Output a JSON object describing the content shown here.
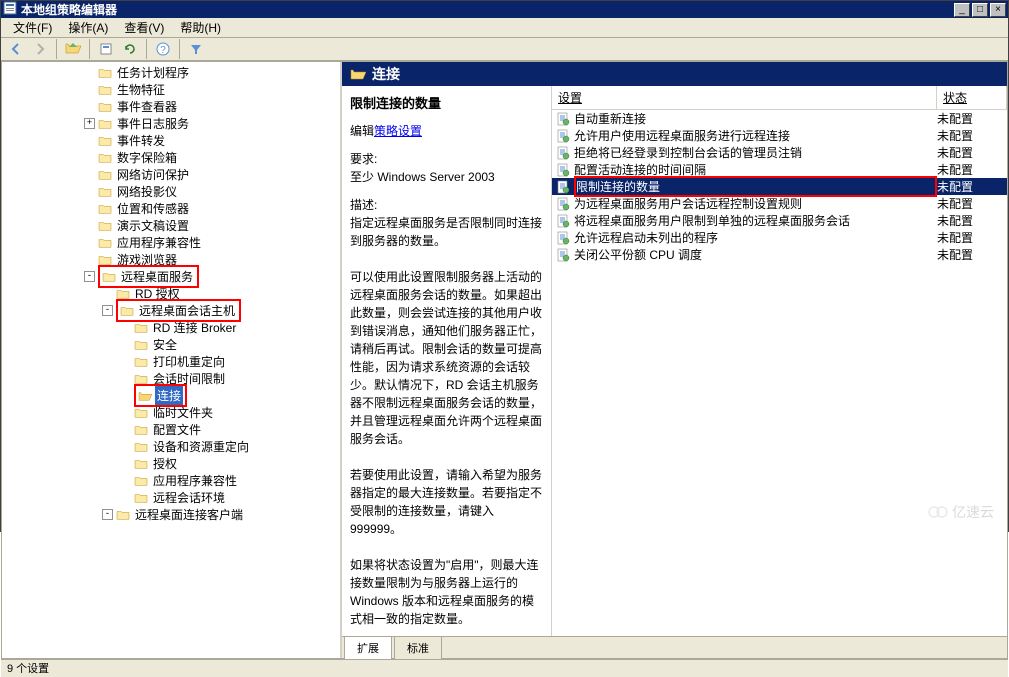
{
  "window": {
    "title": "本地组策略编辑器",
    "minimize": "_",
    "maximize": "□",
    "close": "×"
  },
  "menu": {
    "file": "文件(F)",
    "action": "操作(A)",
    "view": "查看(V)",
    "help": "帮助(H)"
  },
  "tree": {
    "nodes": [
      "任务计划程序",
      "生物特征",
      "事件查看器",
      "事件日志服务",
      "事件转发",
      "数字保险箱",
      "网络访问保护",
      "网络投影仪",
      "位置和传感器",
      "演示文稿设置",
      "应用程序兼容性",
      "游戏浏览器"
    ],
    "rds": "远程桌面服务",
    "rd_auth": "RD 授权",
    "rdsh": "远程桌面会话主机",
    "rdsh_children": [
      "RD 连接 Broker",
      "安全",
      "打印机重定向",
      "会话时间限制"
    ],
    "connections": "连接",
    "rdsh_children2": [
      "临时文件夹",
      "配置文件",
      "设备和资源重定向",
      "授权",
      "应用程序兼容性",
      "远程会话环境"
    ],
    "rdcc": "远程桌面连接客户端"
  },
  "right": {
    "header": "连接",
    "desc_title": "限制连接的数量",
    "edit_label": "编辑",
    "edit_link": "策略设置",
    "req_label": "要求:",
    "req_val": "至少 Windows Server 2003",
    "desc_label": "描述:",
    "desc_body": "指定远程桌面服务是否限制同时连接到服务器的数量。\n\n可以使用此设置限制服务器上活动的远程桌面服务会话的数量。如果超出此数量，则会尝试连接的其他用户收到错误消息，通知他们服务器正忙，请稍后再试。限制会话的数量可提高性能，因为请求系统资源的会话较少。默认情况下，RD 会话主机服务器不限制远程桌面服务会话的数量，并且管理远程桌面允许两个远程桌面服务会话。\n\n若要使用此设置，请输入希望为服务器指定的最大连接数量。若要指定不受限制的连接数量，请键入 999999。\n\n如果将状态设置为\"启用\"，则最大连接数量限制为与服务器上运行的 Windows 版本和远程桌面服务的模式相一致的指定数量。"
  },
  "settings": {
    "col_name": "设置",
    "col_state": "状态",
    "rows": [
      {
        "name": "自动重新连接",
        "state": "未配置"
      },
      {
        "name": "允许用户使用远程桌面服务进行远程连接",
        "state": "未配置"
      },
      {
        "name": "拒绝将已经登录到控制台会话的管理员注销",
        "state": "未配置"
      },
      {
        "name": "配置活动连接的时间间隔",
        "state": "未配置"
      },
      {
        "name": "限制连接的数量",
        "state": "未配置"
      },
      {
        "name": "为远程桌面服务用户会话远程控制设置规则",
        "state": "未配置"
      },
      {
        "name": "将远程桌面服务用户限制到单独的远程桌面服务会话",
        "state": "未配置"
      },
      {
        "name": "允许远程启动未列出的程序",
        "state": "未配置"
      },
      {
        "name": "关闭公平份额 CPU 调度",
        "state": "未配置"
      }
    ]
  },
  "tabs": {
    "extended": "扩展",
    "standard": "标准"
  },
  "status": "9 个设置",
  "watermark": "亿速云"
}
